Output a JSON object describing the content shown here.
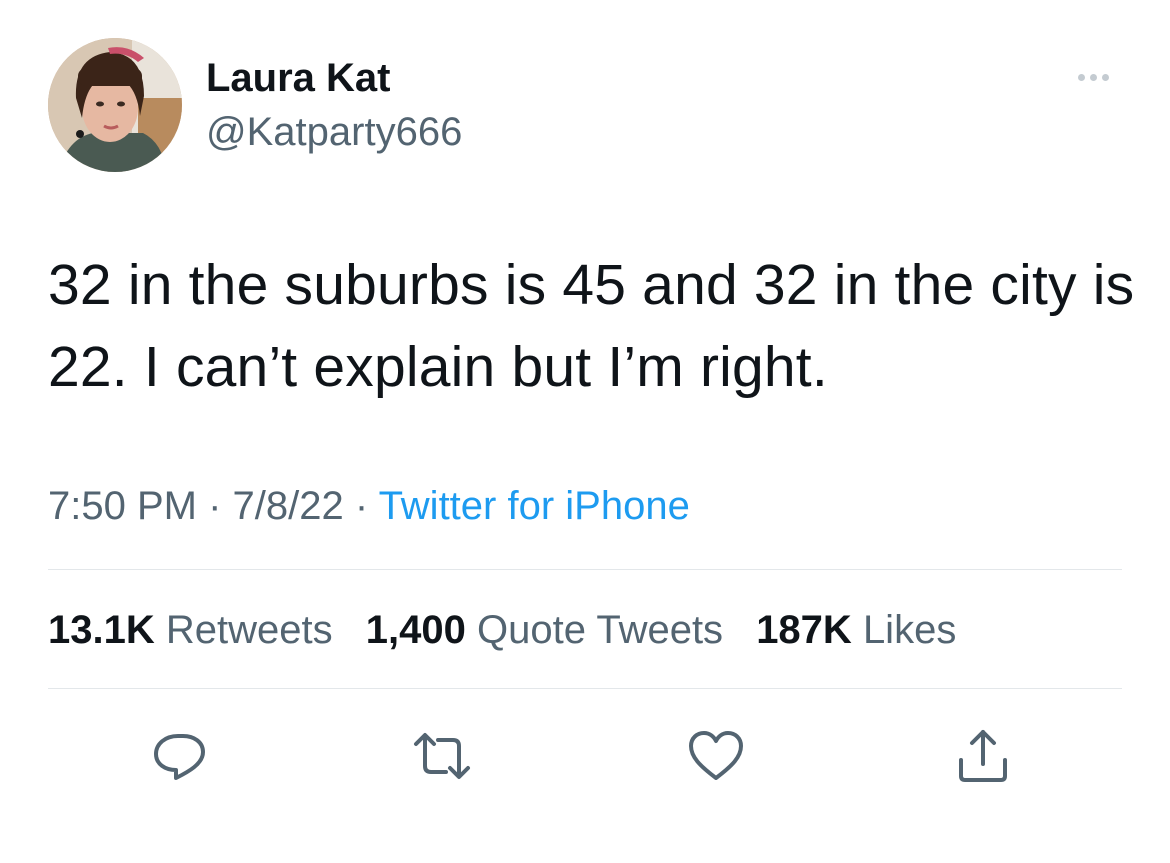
{
  "author": {
    "name": "Laura Kat",
    "handle": "@Katparty666"
  },
  "tweet": {
    "text": "32 in the suburbs is 45 and 32 in the city is 22. I can’t explain but I’m right.",
    "time": "7:50 PM",
    "separator": " · ",
    "date": "7/8/22",
    "source": "Twitter for iPhone"
  },
  "stats": {
    "retweets_count": "13.1K",
    "retweets_label": "Retweets",
    "quotes_count": "1,400",
    "quotes_label": "Quote Tweets",
    "likes_count": "187K",
    "likes_label": "Likes"
  },
  "icons": {
    "more": "more-dots-icon",
    "reply": "reply-icon",
    "retweet": "retweet-icon",
    "like": "heart-icon",
    "share": "share-icon"
  },
  "colors": {
    "text": "#0f1419",
    "secondary": "#536471",
    "link": "#1d9bf0",
    "divider": "#e3e7ea"
  }
}
